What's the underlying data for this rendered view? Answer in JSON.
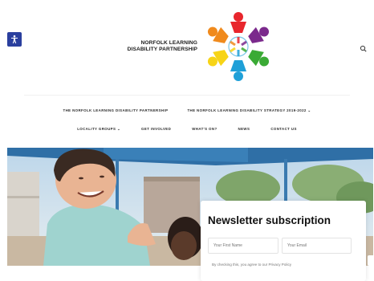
{
  "header": {
    "accessibility_icon": "accessibility-person-icon",
    "logo_line1": "NORFOLK LEARNING",
    "logo_line2": "DISABILITY PARTNERSHIP",
    "search_icon": "search-icon"
  },
  "nav": {
    "row1": [
      {
        "label": "THE NORFOLK LEARNING DISABILITY PARTNERSHIP"
      },
      {
        "label": "THE NORFOLK LEARNING DISABILITY STRATEGY 2019-2022 ⌄"
      }
    ],
    "row2": [
      {
        "label": "LOCALITY GROUPS ⌄"
      },
      {
        "label": "GET INVOLVED"
      },
      {
        "label": "WHAT'S ON?"
      },
      {
        "label": "NEWS"
      },
      {
        "label": "CONTACT US"
      }
    ]
  },
  "newsletter": {
    "title": "Newsletter subscription",
    "first_name_placeholder": "Your First Name",
    "email_placeholder": "Your Email",
    "consent_text": "By checking this, you agree to our Privacy Policy"
  },
  "colors": {
    "accessibility_bg": "#2a3f9e",
    "logo_colors": [
      "#e8262d",
      "#7b2a8c",
      "#1fa0d8",
      "#3aaa35",
      "#f7d417",
      "#f08a1d"
    ]
  }
}
